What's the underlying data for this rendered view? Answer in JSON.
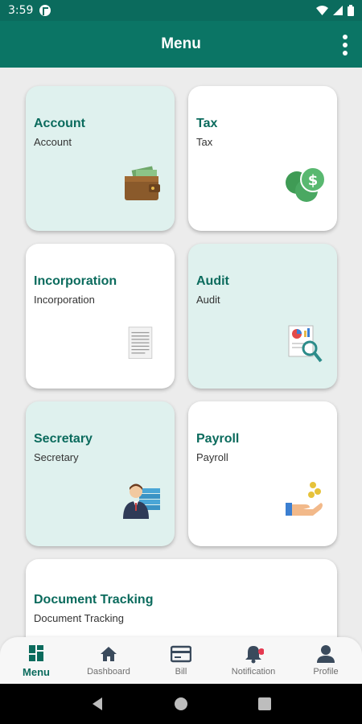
{
  "status_bar": {
    "time": "3:59"
  },
  "app_bar": {
    "title": "Menu"
  },
  "cards": [
    {
      "title": "Account",
      "subtitle": "Account",
      "icon": "wallet-icon"
    },
    {
      "title": "Tax",
      "subtitle": "Tax",
      "icon": "dollar-coins-icon"
    },
    {
      "title": "Incorporation",
      "subtitle": "Incorporation",
      "icon": "document-icon"
    },
    {
      "title": "Audit",
      "subtitle": "Audit",
      "icon": "report-magnifier-icon"
    },
    {
      "title": "Secretary",
      "subtitle": "Secretary",
      "icon": "person-files-icon"
    },
    {
      "title": "Payroll",
      "subtitle": "Payroll",
      "icon": "hand-coins-icon"
    },
    {
      "title": "Document Tracking",
      "subtitle": "Document Tracking",
      "icon": "tracking-icon"
    }
  ],
  "bottom_nav": [
    {
      "label": "Menu",
      "icon": "grid-icon",
      "active": true
    },
    {
      "label": "Dashboard",
      "icon": "home-icon",
      "active": false
    },
    {
      "label": "Bill",
      "icon": "bill-card-icon",
      "active": false
    },
    {
      "label": "Notification",
      "icon": "bell-icon",
      "active": false
    },
    {
      "label": "Profile",
      "icon": "person-icon",
      "active": false
    }
  ],
  "colors": {
    "primary": "#0b7565",
    "mint_card": "#dff1ee",
    "notification_dot": "#e53950"
  }
}
